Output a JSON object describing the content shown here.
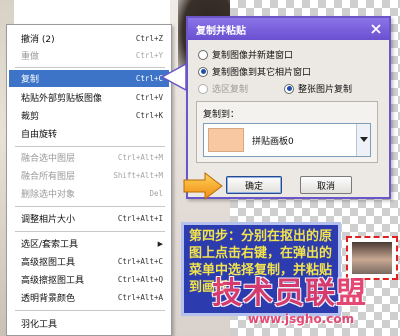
{
  "menu": {
    "items": [
      {
        "label": "撤消 (2)",
        "shortcut": "Ctrl+Z"
      },
      {
        "label": "重做",
        "shortcut": "Ctrl+Y"
      },
      {
        "label": "复制",
        "shortcut": "Ctrl+C"
      },
      {
        "label": "粘贴外部剪贴板图像",
        "shortcut": "Ctrl+V"
      },
      {
        "label": "裁剪",
        "shortcut": "Ctrl+K"
      },
      {
        "label": "自由旋转",
        "shortcut": ""
      },
      {
        "label": "融合选中图层",
        "shortcut": "Ctrl+Alt+M"
      },
      {
        "label": "融合所有图层",
        "shortcut": "Shift+Alt+M"
      },
      {
        "label": "删除选中对象",
        "shortcut": "Del"
      },
      {
        "label": "调整相片大小",
        "shortcut": "Ctrl+Alt+I"
      },
      {
        "label": "选区/套索工具",
        "shortcut": ""
      },
      {
        "label": "高级抠图工具",
        "shortcut": "Ctrl+Alt+C"
      },
      {
        "label": "高级擦抠图工具",
        "shortcut": "Ctrl+Alt+Q"
      },
      {
        "label": "透明背景颜色",
        "shortcut": "Ctrl+Alt+A"
      },
      {
        "label": "羽化工具",
        "shortcut": ""
      }
    ]
  },
  "dialog": {
    "title": "复制并粘贴",
    "option_new_window": "复制图像并新建窗口",
    "option_other_canvas": "复制图像到其它相片窗口",
    "option_selection": "选区复制",
    "option_whole": "整张图片复制",
    "group_label": "复制到：",
    "target_value": "拼贴画板0",
    "ok_label": "确定",
    "cancel_label": "取消"
  },
  "note": {
    "text": "第四步：分别在抠出的原图上点击右键，在弹出的菜单中选择复制，并粘贴到画板"
  },
  "watermark": {
    "logo": "技术员联盟",
    "url": "www.jsgho.com"
  },
  "colors": {
    "menu_highlight": "#3d74c8",
    "dialog_title": "#6a50d0",
    "note_bg": "#2c3cae",
    "note_text": "#f2e34c",
    "watermark": "#e43a6a",
    "swatch": "#f8c8a2"
  }
}
